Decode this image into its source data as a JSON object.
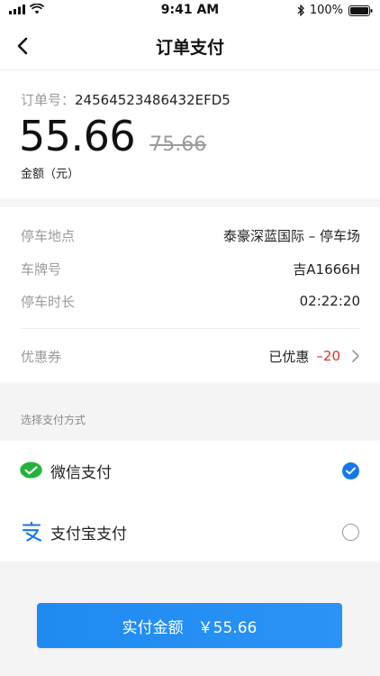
{
  "status": {
    "time": "9:41 AM",
    "battery": "100%"
  },
  "nav": {
    "title": "订单支付"
  },
  "order": {
    "no_label": "订单号：",
    "no_value": "24564523486432EFD5",
    "amount": "55.66",
    "amount_original": "75.66",
    "amount_caption": "金额（元）"
  },
  "info": {
    "rows": [
      {
        "key": "停车地点",
        "value": "泰豪深蓝国际 – 停车场"
      },
      {
        "key": "车牌号",
        "value": "吉A1666H"
      },
      {
        "key": "停车时长",
        "value": "02:22:20"
      }
    ],
    "coupon": {
      "key": "优惠券",
      "status": "已优惠",
      "discount": "–20"
    }
  },
  "payment": {
    "section_title": "选择支付方式",
    "methods": [
      {
        "name": "微信支付",
        "icon": "wechat-pay-icon",
        "selected": true
      },
      {
        "name": "支付宝支付",
        "icon": "alipay-icon",
        "selected": false
      }
    ]
  },
  "pay_button": {
    "label": "实付金额",
    "amount": "￥55.66"
  },
  "colors": {
    "accent": "#1677e6",
    "discount": "#d9302c",
    "wechat": "#23b33b",
    "alipay": "#1677e6"
  }
}
